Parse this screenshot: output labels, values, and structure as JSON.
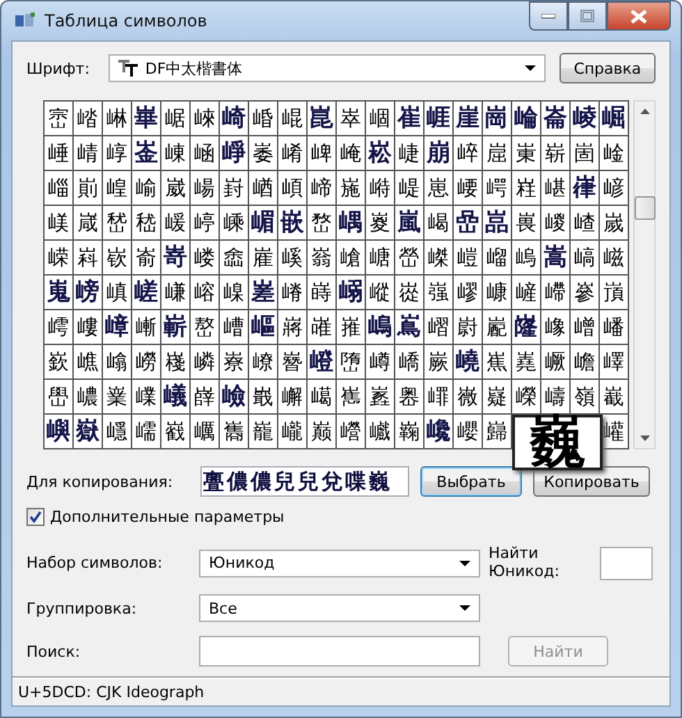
{
  "window": {
    "title": "Таблица символов"
  },
  "font": {
    "label": "Шрифт:",
    "value": "DF中太楷書体"
  },
  "help_button": "Справка",
  "grid": {
    "rows": [
      [
        {
          "kind": "glyph",
          "char": "崈",
          "bold": false
        },
        {
          "kind": "glyph",
          "char": "崉",
          "bold": false
        },
        {
          "kind": "glyph",
          "char": "崊",
          "bold": false
        },
        {
          "kind": "glyph",
          "char": "崋",
          "bold": true
        },
        {
          "kind": "glyph",
          "char": "崌",
          "bold": false
        },
        {
          "kind": "glyph",
          "char": "崍",
          "bold": false
        },
        {
          "kind": "glyph",
          "char": "崎",
          "bold": true
        },
        {
          "kind": "glyph",
          "char": "崏",
          "bold": false
        },
        {
          "kind": "glyph",
          "char": "崐",
          "bold": false
        },
        {
          "kind": "glyph",
          "char": "崑",
          "bold": true
        },
        {
          "kind": "glyph",
          "char": "崒",
          "bold": false
        },
        {
          "kind": "glyph",
          "char": "崓",
          "bold": false
        },
        {
          "kind": "glyph",
          "char": "崔",
          "bold": true
        },
        {
          "kind": "glyph",
          "char": "崕",
          "bold": true
        },
        {
          "kind": "glyph",
          "char": "崖",
          "bold": true
        },
        {
          "kind": "glyph",
          "char": "崗",
          "bold": true
        },
        {
          "kind": "glyph",
          "char": "崘",
          "bold": true
        },
        {
          "kind": "glyph",
          "char": "崙",
          "bold": true
        },
        {
          "kind": "glyph",
          "char": "崚",
          "bold": true
        },
        {
          "kind": "glyph",
          "char": "崛",
          "bold": true
        }
      ],
      [
        {
          "kind": "glyph",
          "char": "崜",
          "bold": false
        },
        {
          "kind": "glyph",
          "char": "崝",
          "bold": false
        },
        {
          "kind": "glyph",
          "char": "崞",
          "bold": false
        },
        {
          "kind": "glyph",
          "char": "崟",
          "bold": true
        },
        {
          "kind": "glyph",
          "char": "崠",
          "bold": false
        },
        {
          "kind": "glyph",
          "char": "崡",
          "bold": false
        },
        {
          "kind": "glyph",
          "char": "崢",
          "bold": true
        },
        {
          "kind": "glyph",
          "char": "崣",
          "bold": false
        },
        {
          "kind": "glyph",
          "char": "崤",
          "bold": false
        },
        {
          "kind": "glyph",
          "char": "崥",
          "bold": false
        },
        {
          "kind": "glyph",
          "char": "崦",
          "bold": false
        },
        {
          "kind": "glyph",
          "char": "崧",
          "bold": true
        },
        {
          "kind": "glyph",
          "char": "崨",
          "bold": false
        },
        {
          "kind": "glyph",
          "char": "崩",
          "bold": true
        },
        {
          "kind": "glyph",
          "char": "崪",
          "bold": false
        },
        {
          "kind": "glyph",
          "char": "崫",
          "bold": false
        },
        {
          "kind": "glyph",
          "char": "崬",
          "bold": false
        },
        {
          "kind": "glyph",
          "char": "崭",
          "bold": false
        },
        {
          "kind": "glyph",
          "char": "崮",
          "bold": false
        },
        {
          "kind": "glyph",
          "char": "崯",
          "bold": false
        }
      ],
      [
        {
          "kind": "glyph",
          "char": "崰",
          "bold": false
        },
        {
          "kind": "glyph",
          "char": "崱",
          "bold": false
        },
        {
          "kind": "glyph",
          "char": "崲",
          "bold": false
        },
        {
          "kind": "glyph",
          "char": "崳",
          "bold": false
        },
        {
          "kind": "glyph",
          "char": "崴",
          "bold": false
        },
        {
          "kind": "glyph",
          "char": "崵",
          "bold": false
        },
        {
          "kind": "glyph",
          "char": "崶",
          "bold": false
        },
        {
          "kind": "glyph",
          "char": "崷",
          "bold": false
        },
        {
          "kind": "glyph",
          "char": "崸",
          "bold": false
        },
        {
          "kind": "glyph",
          "char": "崹",
          "bold": false
        },
        {
          "kind": "glyph",
          "char": "崺",
          "bold": false
        },
        {
          "kind": "glyph",
          "char": "崻",
          "bold": false
        },
        {
          "kind": "glyph",
          "char": "崼",
          "bold": false
        },
        {
          "kind": "glyph",
          "char": "崽",
          "bold": false
        },
        {
          "kind": "glyph",
          "char": "崾",
          "bold": false
        },
        {
          "kind": "glyph",
          "char": "崿",
          "bold": false
        },
        {
          "kind": "glyph",
          "char": "嵀",
          "bold": false
        },
        {
          "kind": "glyph",
          "char": "嵁",
          "bold": false
        },
        {
          "kind": "glyph",
          "char": "嵂",
          "bold": true
        },
        {
          "kind": "glyph",
          "char": "嵃",
          "bold": false
        }
      ],
      [
        {
          "kind": "glyph",
          "char": "嵄",
          "bold": false
        },
        {
          "kind": "glyph",
          "char": "嵅",
          "bold": false
        },
        {
          "kind": "glyph",
          "char": "嵆",
          "bold": false
        },
        {
          "kind": "glyph",
          "char": "嵇",
          "bold": false
        },
        {
          "kind": "glyph",
          "char": "嵈",
          "bold": false
        },
        {
          "kind": "glyph",
          "char": "嵉",
          "bold": false
        },
        {
          "kind": "glyph",
          "char": "嵊",
          "bold": false
        },
        {
          "kind": "glyph",
          "char": "嵋",
          "bold": true
        },
        {
          "kind": "glyph",
          "char": "嵌",
          "bold": true
        },
        {
          "kind": "glyph",
          "char": "嵍",
          "bold": false
        },
        {
          "kind": "glyph",
          "char": "嵎",
          "bold": true
        },
        {
          "kind": "glyph",
          "char": "嵏",
          "bold": false
        },
        {
          "kind": "glyph",
          "char": "嵐",
          "bold": true
        },
        {
          "kind": "glyph",
          "char": "嵑",
          "bold": false
        },
        {
          "kind": "glyph",
          "char": "嵒",
          "bold": true
        },
        {
          "kind": "glyph",
          "char": "嵓",
          "bold": true
        },
        {
          "kind": "glyph",
          "char": "嵔",
          "bold": false
        },
        {
          "kind": "glyph",
          "char": "嵕",
          "bold": false
        },
        {
          "kind": "glyph",
          "char": "嵖",
          "bold": false
        },
        {
          "kind": "glyph",
          "char": "嵗",
          "bold": false
        }
      ],
      [
        {
          "kind": "glyph",
          "char": "嵘",
          "bold": false
        },
        {
          "kind": "glyph",
          "char": "嵙",
          "bold": false
        },
        {
          "kind": "glyph",
          "char": "嵚",
          "bold": false
        },
        {
          "kind": "glyph",
          "char": "嵛",
          "bold": false
        },
        {
          "kind": "glyph",
          "char": "嵜",
          "bold": true
        },
        {
          "kind": "glyph",
          "char": "嵝",
          "bold": false
        },
        {
          "kind": "glyph",
          "char": "嵞",
          "bold": false
        },
        {
          "kind": "glyph",
          "char": "嵟",
          "bold": false
        },
        {
          "kind": "glyph",
          "char": "嵠",
          "bold": false
        },
        {
          "kind": "glyph",
          "char": "嵡",
          "bold": false
        },
        {
          "kind": "glyph",
          "char": "嵢",
          "bold": false
        },
        {
          "kind": "glyph",
          "char": "嵣",
          "bold": false
        },
        {
          "kind": "glyph",
          "char": "嵤",
          "bold": false
        },
        {
          "kind": "glyph",
          "char": "嵥",
          "bold": false
        },
        {
          "kind": "glyph",
          "char": "嵦",
          "bold": false
        },
        {
          "kind": "glyph",
          "char": "嵧",
          "bold": false
        },
        {
          "kind": "glyph",
          "char": "嵨",
          "bold": false
        },
        {
          "kind": "glyph",
          "char": "嵩",
          "bold": true
        },
        {
          "kind": "glyph",
          "char": "嵪",
          "bold": false
        },
        {
          "kind": "glyph",
          "char": "嵫",
          "bold": false
        }
      ],
      [
        {
          "kind": "glyph",
          "char": "嵬",
          "bold": true
        },
        {
          "kind": "glyph",
          "char": "嵭",
          "bold": true
        },
        {
          "kind": "glyph",
          "char": "嵮",
          "bold": false
        },
        {
          "kind": "glyph",
          "char": "嵯",
          "bold": true
        },
        {
          "kind": "glyph",
          "char": "嵰",
          "bold": false
        },
        {
          "kind": "glyph",
          "char": "嵱",
          "bold": false
        },
        {
          "kind": "glyph",
          "char": "嵲",
          "bold": false
        },
        {
          "kind": "glyph",
          "char": "嵳",
          "bold": true
        },
        {
          "kind": "glyph",
          "char": "嵴",
          "bold": false
        },
        {
          "kind": "glyph",
          "char": "嵵",
          "bold": false
        },
        {
          "kind": "glyph",
          "char": "嵶",
          "bold": true
        },
        {
          "kind": "glyph",
          "char": "嵷",
          "bold": false
        },
        {
          "kind": "glyph",
          "char": "嵸",
          "bold": false
        },
        {
          "kind": "glyph",
          "char": "嵹",
          "bold": false
        },
        {
          "kind": "glyph",
          "char": "嵺",
          "bold": false
        },
        {
          "kind": "glyph",
          "char": "嵻",
          "bold": false
        },
        {
          "kind": "glyph",
          "char": "嵼",
          "bold": false
        },
        {
          "kind": "glyph",
          "char": "嵽",
          "bold": false
        },
        {
          "kind": "glyph",
          "char": "嵾",
          "bold": false
        },
        {
          "kind": "glyph",
          "char": "嵿",
          "bold": false
        }
      ],
      [
        {
          "kind": "glyph",
          "char": "嶀",
          "bold": false
        },
        {
          "kind": "glyph",
          "char": "嶁",
          "bold": false
        },
        {
          "kind": "glyph",
          "char": "嶂",
          "bold": true
        },
        {
          "kind": "glyph",
          "char": "嶃",
          "bold": false
        },
        {
          "kind": "glyph",
          "char": "嶄",
          "bold": true
        },
        {
          "kind": "glyph",
          "char": "嶅",
          "bold": false
        },
        {
          "kind": "glyph",
          "char": "嶆",
          "bold": false
        },
        {
          "kind": "glyph",
          "char": "嶇",
          "bold": true
        },
        {
          "kind": "glyph",
          "char": "嶈",
          "bold": false
        },
        {
          "kind": "glyph",
          "char": "嶉",
          "bold": false
        },
        {
          "kind": "glyph",
          "char": "嶊",
          "bold": false
        },
        {
          "kind": "glyph",
          "char": "嶋",
          "bold": true
        },
        {
          "kind": "glyph",
          "char": "嶌",
          "bold": true
        },
        {
          "kind": "glyph",
          "char": "嶍",
          "bold": false
        },
        {
          "kind": "glyph",
          "char": "嶎",
          "bold": false
        },
        {
          "kind": "glyph",
          "char": "嶏",
          "bold": false
        },
        {
          "kind": "glyph",
          "char": "嶐",
          "bold": true
        },
        {
          "kind": "glyph",
          "char": "嶑",
          "bold": false
        },
        {
          "kind": "glyph",
          "char": "嶒",
          "bold": false
        },
        {
          "kind": "glyph",
          "char": "嶓",
          "bold": false
        }
      ],
      [
        {
          "kind": "glyph",
          "char": "嶔",
          "bold": false
        },
        {
          "kind": "glyph",
          "char": "嶕",
          "bold": false
        },
        {
          "kind": "glyph",
          "char": "嶖",
          "bold": false
        },
        {
          "kind": "glyph",
          "char": "嶗",
          "bold": false
        },
        {
          "kind": "glyph",
          "char": "嶘",
          "bold": false
        },
        {
          "kind": "glyph",
          "char": "嶙",
          "bold": false
        },
        {
          "kind": "glyph",
          "char": "嶚",
          "bold": false
        },
        {
          "kind": "glyph",
          "char": "嶛",
          "bold": false
        },
        {
          "kind": "glyph",
          "char": "嶜",
          "bold": false
        },
        {
          "kind": "glyph",
          "char": "嶝",
          "bold": true
        },
        {
          "kind": "glyph",
          "char": "嶞",
          "bold": false
        },
        {
          "kind": "glyph",
          "char": "嶟",
          "bold": false
        },
        {
          "kind": "glyph",
          "char": "嶠",
          "bold": false
        },
        {
          "kind": "glyph",
          "char": "嶡",
          "bold": false
        },
        {
          "kind": "glyph",
          "char": "嶢",
          "bold": true
        },
        {
          "kind": "glyph",
          "char": "嶣",
          "bold": false
        },
        {
          "kind": "glyph",
          "char": "嶤",
          "bold": false
        },
        {
          "kind": "glyph",
          "char": "嶥",
          "bold": false
        },
        {
          "kind": "glyph",
          "char": "嶦",
          "bold": false
        },
        {
          "kind": "glyph",
          "char": "嶧",
          "bold": false
        }
      ],
      [
        {
          "kind": "glyph",
          "char": "嶨",
          "bold": false
        },
        {
          "kind": "glyph",
          "char": "嶩",
          "bold": false
        },
        {
          "kind": "glyph",
          "char": "嶪",
          "bold": false
        },
        {
          "kind": "glyph",
          "char": "嶫",
          "bold": false
        },
        {
          "kind": "glyph",
          "char": "嶬",
          "bold": true
        },
        {
          "kind": "glyph",
          "char": "嶭",
          "bold": false
        },
        {
          "kind": "glyph",
          "char": "嶮",
          "bold": true
        },
        {
          "kind": "glyph",
          "char": "嶯",
          "bold": false
        },
        {
          "kind": "glyph",
          "char": "嶰",
          "bold": false
        },
        {
          "kind": "glyph",
          "char": "嶱",
          "bold": false
        },
        {
          "kind": "glyph",
          "char": "嶲",
          "bold": false
        },
        {
          "kind": "glyph",
          "char": "嶳",
          "bold": false
        },
        {
          "kind": "glyph",
          "char": "嶴",
          "bold": false
        },
        {
          "kind": "glyph",
          "char": "嶵",
          "bold": false
        },
        {
          "kind": "glyph",
          "char": "嶶",
          "bold": false
        },
        {
          "kind": "glyph",
          "char": "嶷",
          "bold": false
        },
        {
          "kind": "glyph",
          "char": "嶸",
          "bold": false
        },
        {
          "kind": "glyph",
          "char": "嶹",
          "bold": false
        },
        {
          "kind": "glyph",
          "char": "嶺",
          "bold": false
        },
        {
          "kind": "glyph",
          "char": "嶻",
          "bold": false
        }
      ],
      [
        {
          "kind": "glyph",
          "char": "嶼",
          "bold": true
        },
        {
          "kind": "glyph",
          "char": "嶽",
          "bold": true
        },
        {
          "kind": "glyph",
          "char": "嶾",
          "bold": false
        },
        {
          "kind": "glyph",
          "char": "嶿",
          "bold": false
        },
        {
          "kind": "glyph",
          "char": "巀",
          "bold": false
        },
        {
          "kind": "glyph",
          "char": "巁",
          "bold": false
        },
        {
          "kind": "glyph",
          "char": "巂",
          "bold": false
        },
        {
          "kind": "glyph",
          "char": "巃",
          "bold": false
        },
        {
          "kind": "glyph",
          "char": "巄",
          "bold": false
        },
        {
          "kind": "glyph",
          "char": "巅",
          "bold": false
        },
        {
          "kind": "glyph",
          "char": "巆",
          "bold": false
        },
        {
          "kind": "glyph",
          "char": "巇",
          "bold": false
        },
        {
          "kind": "glyph",
          "char": "巈",
          "bold": false
        },
        {
          "kind": "glyph",
          "char": "巉",
          "bold": true
        },
        {
          "kind": "glyph",
          "char": "巊",
          "bold": false
        },
        {
          "kind": "glyph",
          "char": "巋",
          "bold": false
        },
        {
          "kind": "preview",
          "char": "巍"
        },
        {
          "kind": "covered"
        },
        {
          "kind": "covered"
        },
        {
          "kind": "glyph",
          "char": "巏",
          "bold": false
        }
      ]
    ]
  },
  "copy": {
    "label": "Для копирования:",
    "value": "亹儂儂兒兒兌喋巍"
  },
  "select_button": "Выбрать",
  "copy_button": "Копировать",
  "advanced": {
    "label": "Дополнительные параметры",
    "checked": true
  },
  "charset": {
    "label": "Набор символов:",
    "value": "Юникод"
  },
  "find_unicode": {
    "label": "Найти Юникод:"
  },
  "grouping": {
    "label": "Группировка:",
    "value": "Все"
  },
  "search": {
    "label": "Поиск:"
  },
  "search_button": {
    "label": "Найти",
    "disabled": true
  },
  "status_bar": "U+5DCD: CJK Ideograph"
}
